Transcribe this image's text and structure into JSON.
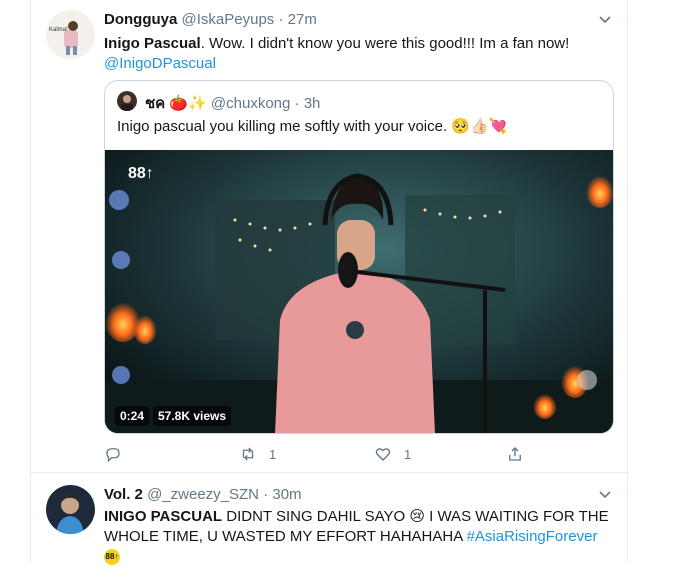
{
  "tweets": [
    {
      "name": "Dongguya",
      "handle": "@IskaPeyups",
      "separator": "·",
      "time": "27m",
      "text_bold": "Inigo Pascual",
      "text": ". Wow. I didn't know you were this good!!! Im a fan now!",
      "mention": "@InigoDPascual",
      "avatar_label": "Kalma!",
      "quote": {
        "name": "ชค",
        "emoji": "🍅✨",
        "handle": "@chuxkong",
        "separator": "·",
        "time": "3h",
        "text": "Inigo pascual you killing me softly with your voice.",
        "text_emoji": "🥺👍🏻💘",
        "video": {
          "logo": "88↑",
          "duration": "0:24",
          "views": "57.8K views"
        }
      },
      "actions": {
        "reply_count": "",
        "retweet_count": "1",
        "like_count": "1"
      }
    },
    {
      "name": "Vol. 2",
      "handle": "@_zweezy_SZN",
      "separator": "·",
      "time": "30m",
      "text_bold": "INIGO PASCUAL",
      "text": " DIDNT SING DAHIL SAYO 😢 I WAS WAITING FOR THE WHOLE TIME, U WASTED MY EFFORT HAHAHAHA ",
      "hashtag": "#AsiaRisingForever",
      "trail_badge": "88↑"
    }
  ],
  "colors": {
    "link": "#1b95e0",
    "secondary": "#657786",
    "border": "#e6ecf0"
  },
  "icons": [
    "chevron-down-icon",
    "reply-icon",
    "retweet-icon",
    "like-icon",
    "share-icon"
  ]
}
